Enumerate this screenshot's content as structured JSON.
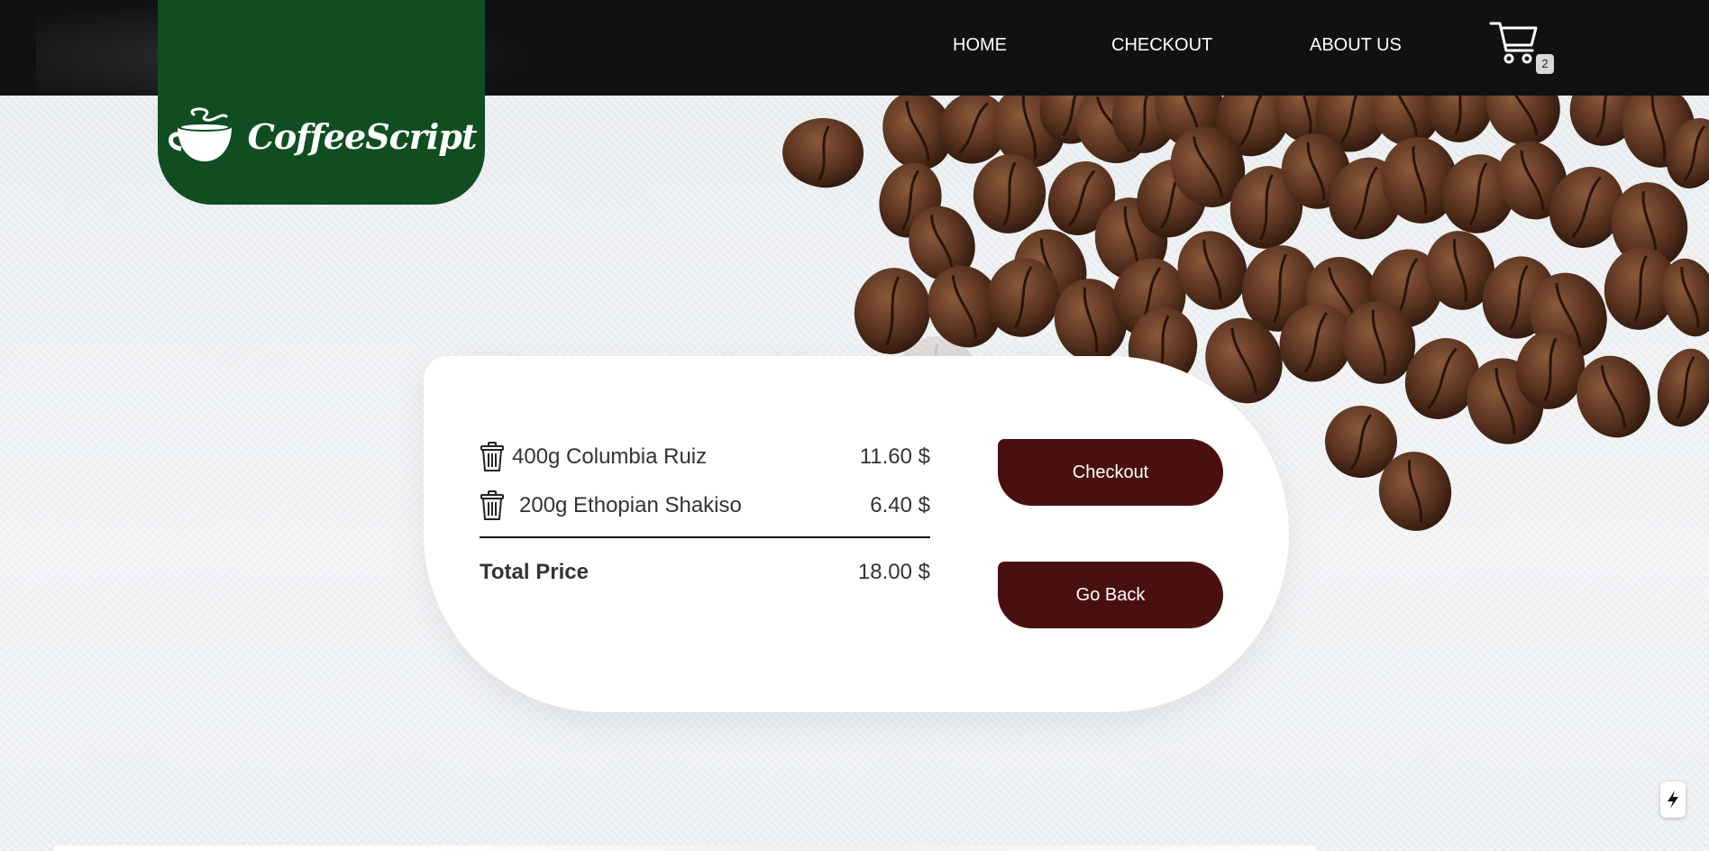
{
  "brand": {
    "name": "CoffeeScript"
  },
  "nav": {
    "items": [
      {
        "label": "HOME"
      },
      {
        "label": "CHECKOUT"
      },
      {
        "label": "ABOUT US"
      }
    ],
    "cart_count": "2"
  },
  "cart": {
    "items": [
      {
        "name": "400g Columbia Ruiz",
        "price": "11.60 $"
      },
      {
        "name": "200g Ethopian Shakiso",
        "price": "6.40 $"
      }
    ],
    "total_label": "Total Price",
    "total_value": "18.00 $"
  },
  "actions": {
    "checkout_label": "Checkout",
    "back_label": "Go Back"
  },
  "colors": {
    "nav_bg": "#101113",
    "brand_green": "#104e22",
    "button_bg": "#4a0f0f"
  }
}
